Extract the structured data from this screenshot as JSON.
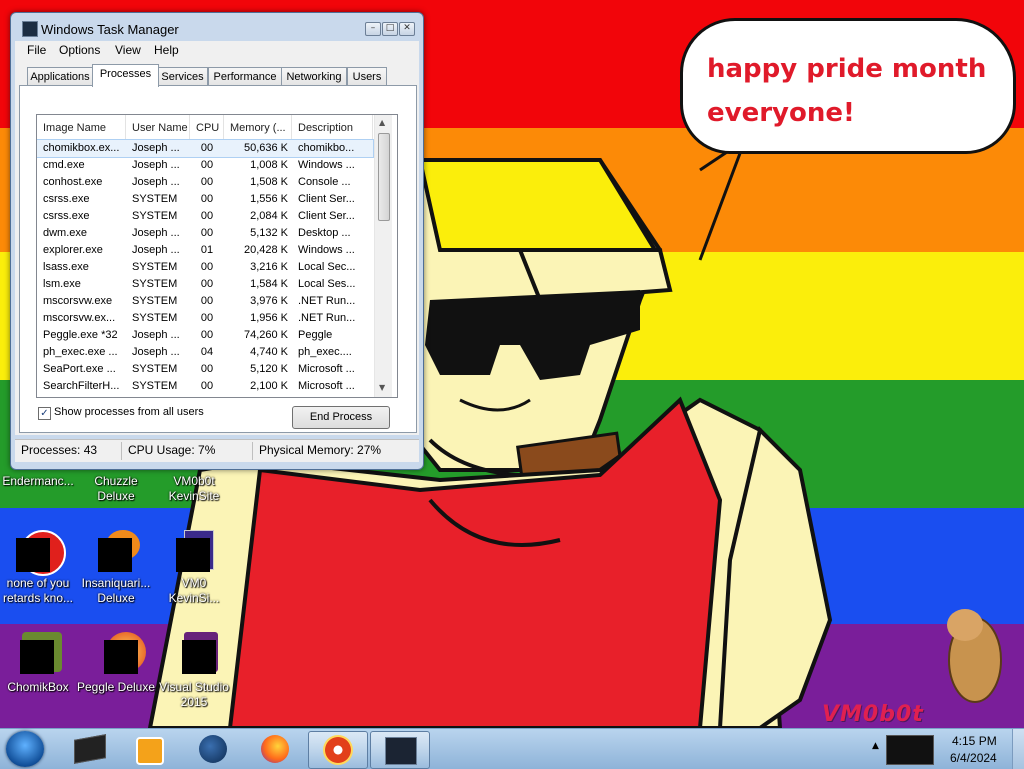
{
  "desktop": {
    "colors": {
      "red": "#f2050a",
      "orange": "#fc8a07",
      "yellow": "#fbee0b",
      "green": "#249c2a",
      "blue": "#1a4ef0",
      "purple": "#7a1e9a"
    },
    "speech_bubble": {
      "line1": "happy pride month",
      "line2": "everyone!"
    },
    "signature": "VM0b0t",
    "icons": [
      {
        "label_line1": "Endermanc...",
        "label_line2": "",
        "icon": "enderman-icon"
      },
      {
        "label_line1": "Chuzzle",
        "label_line2": "Deluxe",
        "icon": "chuzzle-icon"
      },
      {
        "label_line1": "VM0b0t",
        "label_line2": "KevinSite",
        "icon": "website-icon"
      },
      {
        "label_line1": "none of you",
        "label_line2": "retards kno...",
        "icon": "red-circle-icon"
      },
      {
        "label_line1": "Insaniquari...",
        "label_line2": "Deluxe",
        "icon": "insaniquarium-icon"
      },
      {
        "label_line1": "VM0",
        "label_line2": "KevinSi...",
        "icon": "file-icon"
      },
      {
        "label_line1": "ChomikBox",
        "label_line2": "",
        "icon": "chomikbox-icon"
      },
      {
        "label_line1": "Peggle Deluxe",
        "label_line2": "",
        "icon": "peggle-icon"
      },
      {
        "label_line1": "Visual Studio",
        "label_line2": "2015",
        "icon": "visual-studio-icon"
      }
    ]
  },
  "task_manager": {
    "title": "Windows Task Manager",
    "menu": [
      "File",
      "Options",
      "View",
      "Help"
    ],
    "tabs": [
      "Applications",
      "Processes",
      "Services",
      "Performance",
      "Networking",
      "Users"
    ],
    "active_tab": "Processes",
    "columns": [
      "Image Name",
      "User Name",
      "CPU",
      "Memory (...",
      "Description"
    ],
    "rows": [
      {
        "image": "chomikbox.ex...",
        "user": "Joseph ...",
        "cpu": "00",
        "mem": "50,636 K",
        "desc": "chomikbo...",
        "selected": true
      },
      {
        "image": "cmd.exe",
        "user": "Joseph ...",
        "cpu": "00",
        "mem": "1,008 K",
        "desc": "Windows ..."
      },
      {
        "image": "conhost.exe",
        "user": "Joseph ...",
        "cpu": "00",
        "mem": "1,508 K",
        "desc": "Console ..."
      },
      {
        "image": "csrss.exe",
        "user": "SYSTEM",
        "cpu": "00",
        "mem": "1,556 K",
        "desc": "Client Ser..."
      },
      {
        "image": "csrss.exe",
        "user": "SYSTEM",
        "cpu": "00",
        "mem": "2,084 K",
        "desc": "Client Ser..."
      },
      {
        "image": "dwm.exe",
        "user": "Joseph ...",
        "cpu": "00",
        "mem": "5,132 K",
        "desc": "Desktop ..."
      },
      {
        "image": "explorer.exe",
        "user": "Joseph ...",
        "cpu": "01",
        "mem": "20,428 K",
        "desc": "Windows ..."
      },
      {
        "image": "lsass.exe",
        "user": "SYSTEM",
        "cpu": "00",
        "mem": "3,216 K",
        "desc": "Local Sec..."
      },
      {
        "image": "lsm.exe",
        "user": "SYSTEM",
        "cpu": "00",
        "mem": "1,584 K",
        "desc": "Local Ses..."
      },
      {
        "image": "mscorsvw.exe",
        "user": "SYSTEM",
        "cpu": "00",
        "mem": "3,976 K",
        "desc": ".NET Run..."
      },
      {
        "image": "mscorsvw.ex...",
        "user": "SYSTEM",
        "cpu": "00",
        "mem": "1,956 K",
        "desc": ".NET Run..."
      },
      {
        "image": "Peggle.exe *32",
        "user": "Joseph ...",
        "cpu": "00",
        "mem": "74,260 K",
        "desc": "Peggle"
      },
      {
        "image": "ph_exec.exe ...",
        "user": "Joseph ...",
        "cpu": "04",
        "mem": "4,740 K",
        "desc": "ph_exec...."
      },
      {
        "image": "SeaPort.exe ...",
        "user": "SYSTEM",
        "cpu": "00",
        "mem": "5,120 K",
        "desc": "Microsoft ..."
      },
      {
        "image": "SearchFilterH...",
        "user": "SYSTEM",
        "cpu": "00",
        "mem": "2,100 K",
        "desc": "Microsoft ..."
      }
    ],
    "show_all_label": "Show processes from all users",
    "show_all_checked": true,
    "end_process_label": "End Process",
    "status": {
      "processes": "Processes: 43",
      "cpu": "CPU Usage: 7%",
      "memory": "Physical Memory: 27%"
    }
  },
  "taskbar": {
    "apps": [
      "virtualbox-icon",
      "media-player-icon",
      "globe-icon",
      "firefox-icon",
      "peggle-icon",
      "task-manager-icon"
    ],
    "open_apps": [
      "peggle-icon",
      "task-manager-icon"
    ],
    "clock": {
      "time": "4:15 PM",
      "date": "6/4/2024"
    }
  }
}
